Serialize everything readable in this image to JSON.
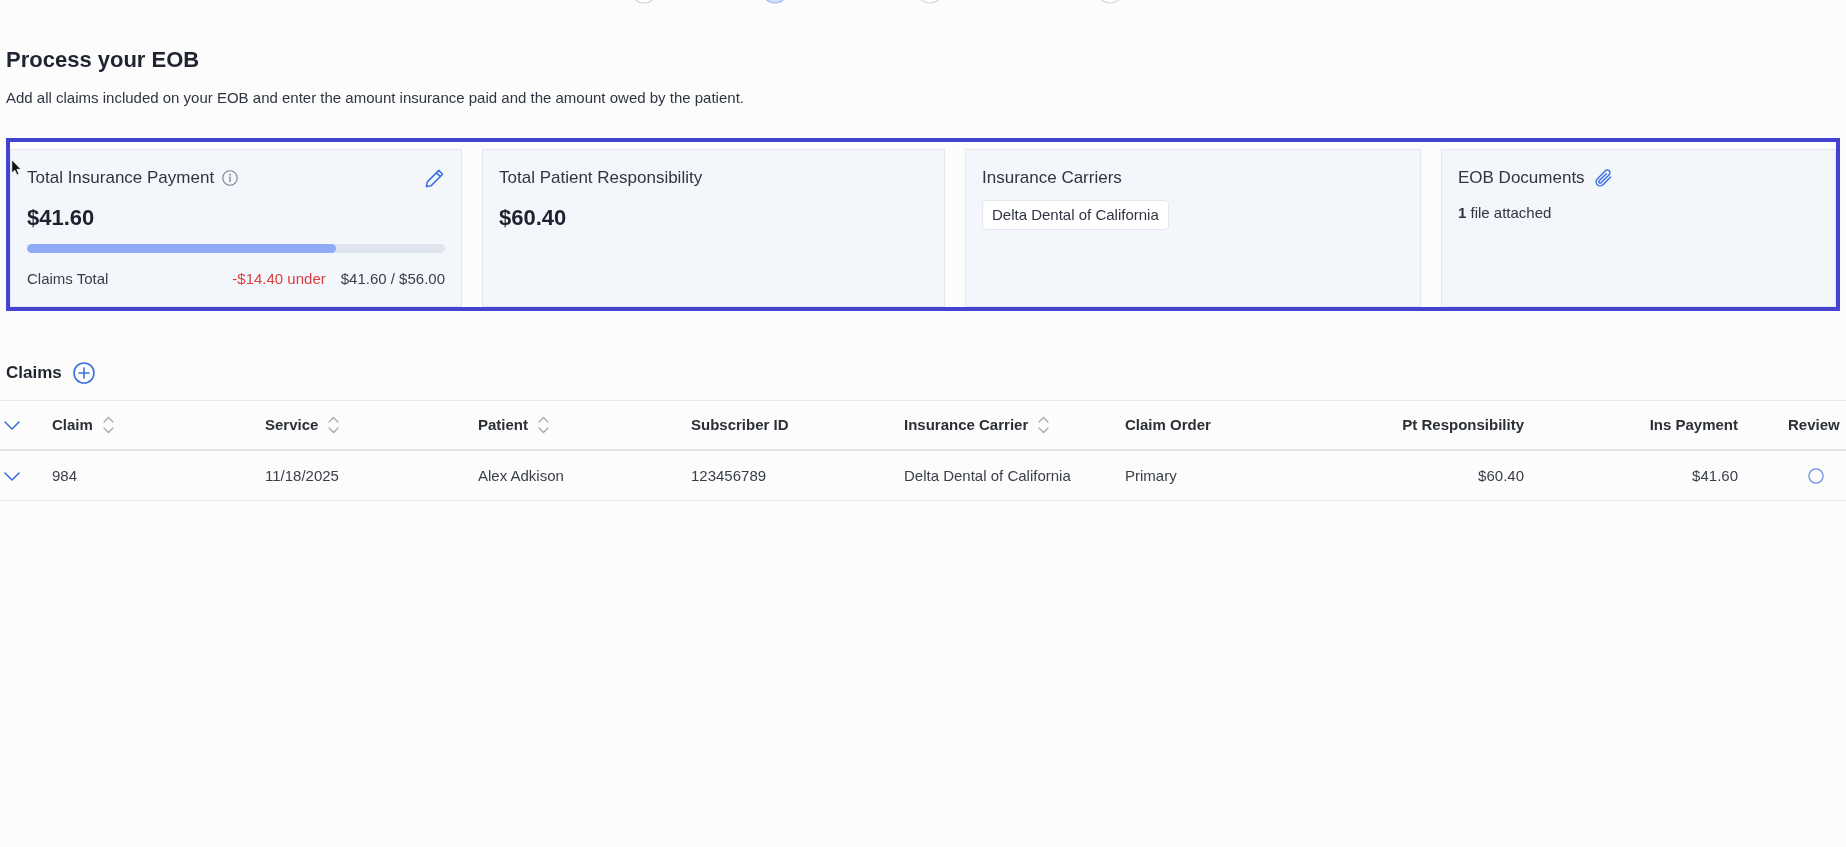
{
  "stepper": {
    "steps": [
      {
        "selected": false
      },
      {
        "selected": true
      },
      {
        "selected": false
      },
      {
        "selected": false
      }
    ]
  },
  "page": {
    "title": "Process your EOB",
    "subtitle": "Add all claims included on your EOB and enter the amount insurance paid and the amount owed by the patient."
  },
  "summary_cards": [
    {
      "kind": "payment",
      "title": "Total Insurance Payment",
      "amount": "$41.60",
      "level": 0.74,
      "footer_label": "Claims Total",
      "difference": "-$14.40 under",
      "ratio": "$41.60 / $56.00"
    },
    {
      "kind": "amount",
      "title": "Total Patient Responsibility",
      "amount": "$60.40"
    },
    {
      "kind": "carriers",
      "title": "Insurance Carriers",
      "tags": [
        "Delta Dental of California"
      ]
    },
    {
      "kind": "documents",
      "title": "EOB Documents",
      "files": "**1** file attached"
    }
  ],
  "claims": {
    "title": "Claims",
    "columns": [
      {
        "label": "Claim",
        "sortable": true,
        "kind": "text"
      },
      {
        "label": "Service",
        "sortable": true,
        "kind": "text"
      },
      {
        "label": "Patient",
        "sortable": true,
        "kind": "text"
      },
      {
        "label": "Subscriber ID",
        "sortable": false,
        "kind": "text"
      },
      {
        "label": "Insurance Carrier",
        "sortable": true,
        "kind": "text"
      },
      {
        "label": "Claim Order",
        "sortable": false,
        "kind": "text"
      },
      {
        "label": "Pt Responsibility",
        "sortable": false,
        "kind": "money"
      },
      {
        "label": "Ins Payment",
        "sortable": false,
        "kind": "money"
      },
      {
        "label": "Review",
        "sortable": false,
        "kind": "status"
      }
    ],
    "rows": [
      {
        "cells": [
          "984",
          "11/18/2025",
          "Alex Adkison",
          "123456789",
          "Delta Dental of California",
          "Primary",
          "$60.40",
          "$41.60"
        ],
        "reviewed": false
      }
    ]
  }
}
